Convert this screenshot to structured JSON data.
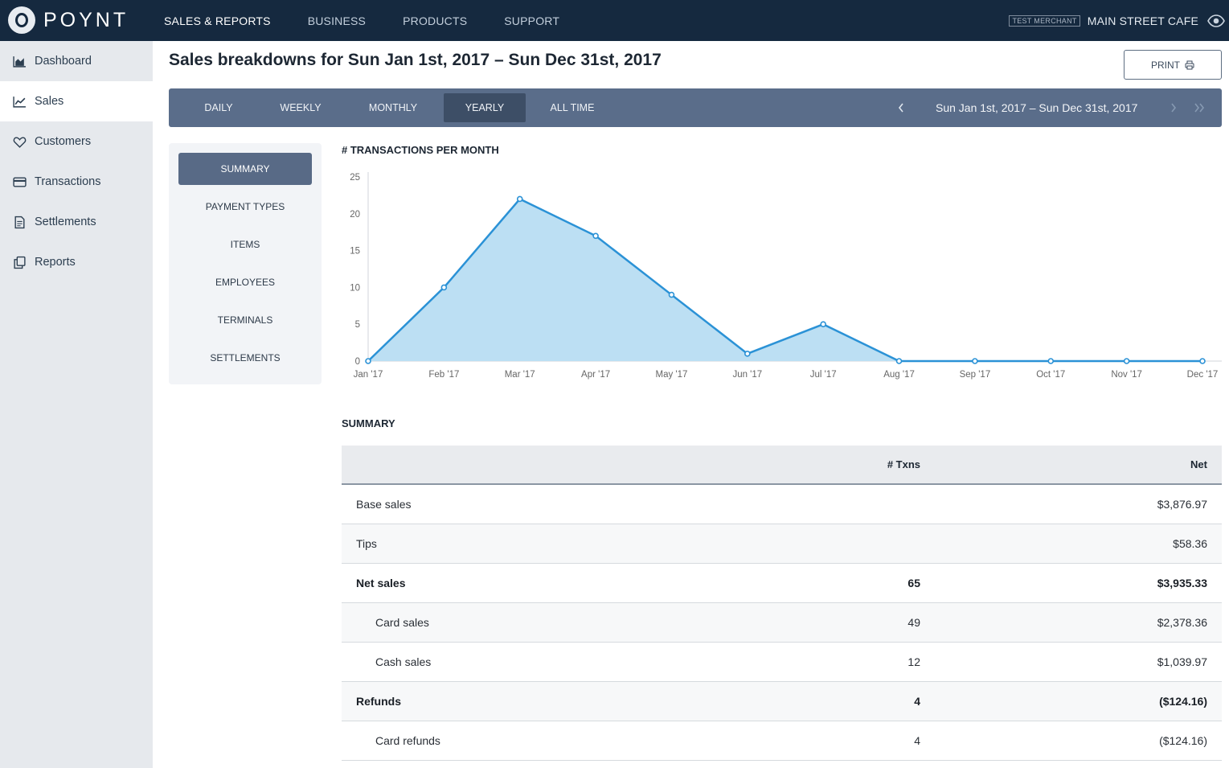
{
  "brand": {
    "name": "POYNT"
  },
  "topnav": [
    {
      "label": "SALES & REPORTS",
      "active": true
    },
    {
      "label": "BUSINESS",
      "active": false
    },
    {
      "label": "PRODUCTS",
      "active": false
    },
    {
      "label": "SUPPORT",
      "active": false
    }
  ],
  "merchant": {
    "badge": "TEST MERCHANT",
    "name": "MAIN STREET CAFE",
    "icon": "eye-icon"
  },
  "sidebar": {
    "items": [
      {
        "label": "Dashboard",
        "icon": "area-chart-icon",
        "active": false
      },
      {
        "label": "Sales",
        "icon": "line-chart-icon",
        "active": true
      },
      {
        "label": "Customers",
        "icon": "heart-icon",
        "active": false
      },
      {
        "label": "Transactions",
        "icon": "credit-card-icon",
        "active": false
      },
      {
        "label": "Settlements",
        "icon": "document-icon",
        "active": false
      },
      {
        "label": "Reports",
        "icon": "copy-icon",
        "active": false
      }
    ]
  },
  "page": {
    "title": "Sales breakdowns for Sun Jan 1st, 2017 – Sun Dec 31st, 2017",
    "print_label": "PRINT"
  },
  "range": {
    "tabs": [
      {
        "label": "DAILY",
        "active": false
      },
      {
        "label": "WEEKLY",
        "active": false
      },
      {
        "label": "MONTHLY",
        "active": false
      },
      {
        "label": "YEARLY",
        "active": true
      },
      {
        "label": "ALL TIME",
        "active": false
      }
    ],
    "current": "Sun Jan 1st, 2017 – Sun Dec 31st, 2017",
    "prev_icon": "chevron-left-icon",
    "next_icon": "chevron-right-icon",
    "last_icon": "double-chevron-right-icon"
  },
  "subnav": [
    {
      "label": "SUMMARY",
      "active": true
    },
    {
      "label": "PAYMENT TYPES",
      "active": false
    },
    {
      "label": "ITEMS",
      "active": false
    },
    {
      "label": "EMPLOYEES",
      "active": false
    },
    {
      "label": "TERMINALS",
      "active": false
    },
    {
      "label": "SETTLEMENTS",
      "active": false
    }
  ],
  "chart_data": {
    "type": "area",
    "title": "# TRANSACTIONS PER MONTH",
    "categories": [
      "Jan '17",
      "Feb '17",
      "Mar '17",
      "Apr '17",
      "May '17",
      "Jun '17",
      "Jul '17",
      "Aug '17",
      "Sep '17",
      "Oct '17",
      "Nov '17",
      "Dec '17"
    ],
    "values": [
      0,
      10,
      22,
      17,
      9,
      1,
      5,
      0,
      0,
      0,
      0,
      0
    ],
    "yticks": [
      0,
      5,
      10,
      15,
      20,
      25
    ],
    "ylim": [
      0,
      25
    ],
    "color": "#2b92d6",
    "fill": "#bcdff3",
    "grid": false,
    "legend": "none"
  },
  "summary": {
    "title": "SUMMARY",
    "columns": {
      "txns": "# Txns",
      "net": "Net"
    },
    "rows": [
      {
        "label": "Base sales",
        "txns": "",
        "net": "$3,876.97",
        "style": "normal"
      },
      {
        "label": "Tips",
        "txns": "",
        "net": "$58.36",
        "style": "normal"
      },
      {
        "label": "Net sales",
        "txns": "65",
        "net": "$3,935.33",
        "style": "bold"
      },
      {
        "label": "Card sales",
        "txns": "49",
        "net": "$2,378.36",
        "style": "indent"
      },
      {
        "label": "Cash sales",
        "txns": "12",
        "net": "$1,039.97",
        "style": "indent"
      },
      {
        "label": "Refunds",
        "txns": "4",
        "net": "($124.16)",
        "style": "bold"
      },
      {
        "label": "Card refunds",
        "txns": "4",
        "net": "($124.16)",
        "style": "indent"
      }
    ]
  }
}
